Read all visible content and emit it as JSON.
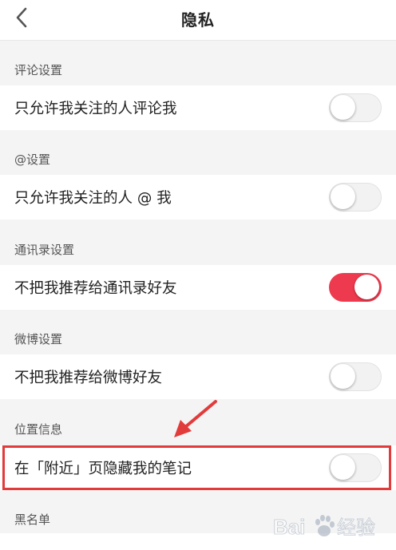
{
  "nav": {
    "title": "隐私",
    "back_icon": "chevron-left-icon"
  },
  "sections": [
    {
      "header": "评论设置",
      "row_label": "只允许我关注的人评论我",
      "toggle_on": false
    },
    {
      "header": "@设置",
      "row_label": "只允许我关注的人 @ 我",
      "toggle_on": false
    },
    {
      "header": "通讯录设置",
      "row_label": "不把我推荐给通讯录好友",
      "toggle_on": true
    },
    {
      "header": "微博设置",
      "row_label": "不把我推荐给微博好友",
      "toggle_on": false
    },
    {
      "header": "位置信息",
      "row_label": "在「附近」页隐藏我的笔记",
      "toggle_on": false
    }
  ],
  "blacklist": {
    "header": "黑名单"
  },
  "annotation": {
    "highlight_color": "#e23b3b",
    "arrow_color": "#e23b3b"
  },
  "colors": {
    "toggle_on": "#ee3a4e",
    "background": "#f4f4f4"
  },
  "watermark": {
    "brand": "Baidu"
  }
}
